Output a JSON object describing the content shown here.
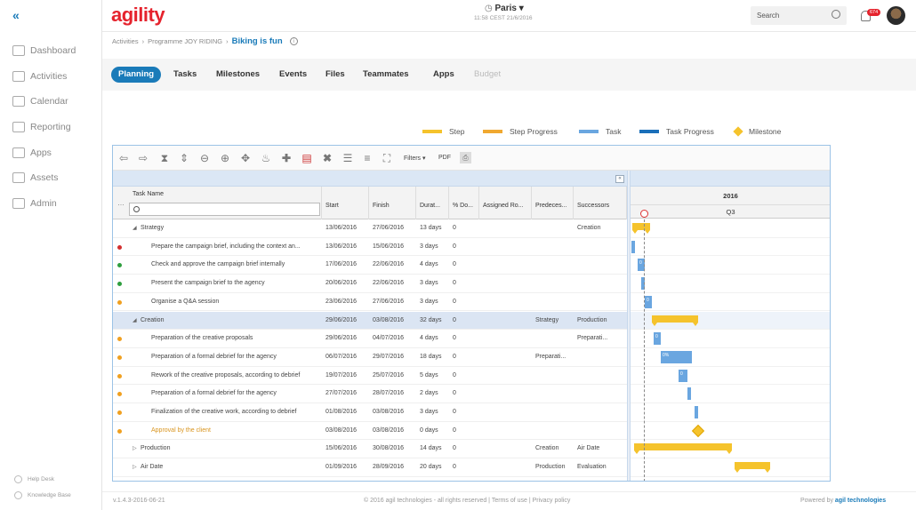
{
  "sidebar": {
    "collapse_icon": "double-chevron-left-icon",
    "items": [
      {
        "label": "Dashboard",
        "icon": "dashboard-icon"
      },
      {
        "label": "Activities",
        "icon": "activities-icon"
      },
      {
        "label": "Calendar",
        "icon": "calendar-icon"
      },
      {
        "label": "Reporting",
        "icon": "chart-icon"
      },
      {
        "label": "Apps",
        "icon": "grid-icon"
      },
      {
        "label": "Assets",
        "icon": "diamond-icon"
      },
      {
        "label": "Admin",
        "icon": "user-icon"
      }
    ],
    "bottom": [
      {
        "label": "Help Desk"
      },
      {
        "label": "Knowledge Base"
      }
    ]
  },
  "header": {
    "logo": "agility",
    "city": "Paris",
    "time": "11:58 CEST 21/6/2016",
    "search_placeholder": "Search",
    "notification_count": "674"
  },
  "breadcrumb": {
    "items": [
      "Activities",
      "Programme JOY RIDING"
    ],
    "current": "Biking is fun"
  },
  "tabs": [
    {
      "label": "Planning",
      "state": "active"
    },
    {
      "label": "Tasks",
      "state": "normal"
    },
    {
      "label": "Milestones",
      "state": "normal"
    },
    {
      "label": "Events",
      "state": "normal"
    },
    {
      "label": "Files",
      "state": "normal"
    },
    {
      "label": "Teammates",
      "state": "normal"
    },
    {
      "label": "Apps",
      "state": "normal"
    },
    {
      "label": "Budget",
      "state": "disabled"
    }
  ],
  "legend": [
    {
      "label": "Step",
      "color": "#f5c32c"
    },
    {
      "label": "Step Progress",
      "color": "#f0a830"
    },
    {
      "label": "Task",
      "color": "#6aa6e0"
    },
    {
      "label": "Task Progress",
      "color": "#1a6fb9"
    },
    {
      "label": "Milestone",
      "color": "#f5c32c"
    }
  ],
  "toolbar": {
    "filters_label": "Filters ▾",
    "pdf_label": "PDF"
  },
  "columns": [
    "Task Name",
    "Start",
    "Finish",
    "Durat...",
    "% Do...",
    "Assigned Ro...",
    "Predeces...",
    "Successors"
  ],
  "timeline": {
    "year": "2016",
    "quarter": "Q3"
  },
  "rows": [
    {
      "dot": "",
      "expander": "◢",
      "name": "Strategy",
      "level": 1,
      "start": "13/06/2016",
      "finish": "27/06/2016",
      "duration": "13 days",
      "pct": "0",
      "assigned": "",
      "pred": "",
      "succ": "Creation"
    },
    {
      "dot": "#d32f2f",
      "expander": "",
      "name": "Prepare the campaign brief, including the context an...",
      "level": 2,
      "start": "13/06/2016",
      "finish": "15/06/2016",
      "duration": "3 days",
      "pct": "0",
      "assigned": "",
      "pred": "",
      "succ": ""
    },
    {
      "dot": "#2e9e3e",
      "expander": "",
      "name": "Check and approve the campaign brief internally",
      "level": 2,
      "start": "17/06/2016",
      "finish": "22/06/2016",
      "duration": "4 days",
      "pct": "0",
      "assigned": "",
      "pred": "",
      "succ": ""
    },
    {
      "dot": "#2e9e3e",
      "expander": "",
      "name": "Present the campaign brief to the agency",
      "level": 2,
      "start": "20/06/2016",
      "finish": "22/06/2016",
      "duration": "3 days",
      "pct": "0",
      "assigned": "",
      "pred": "",
      "succ": ""
    },
    {
      "dot": "#f0a020",
      "expander": "",
      "name": "Organise a Q&A session",
      "level": 2,
      "start": "23/06/2016",
      "finish": "27/06/2016",
      "duration": "3 days",
      "pct": "0",
      "assigned": "",
      "pred": "",
      "succ": ""
    },
    {
      "dot": "",
      "expander": "◢",
      "name": "Creation",
      "level": 1,
      "start": "29/06/2016",
      "finish": "03/08/2016",
      "duration": "32 days",
      "pct": "0",
      "assigned": "",
      "pred": "Strategy",
      "succ": "Production",
      "selected": true
    },
    {
      "dot": "#f0a020",
      "expander": "",
      "name": "Preparation of the creative proposals",
      "level": 2,
      "start": "29/06/2016",
      "finish": "04/07/2016",
      "duration": "4 days",
      "pct": "0",
      "assigned": "",
      "pred": "",
      "succ": "Preparati..."
    },
    {
      "dot": "#f0a020",
      "expander": "",
      "name": "Preparation of a formal debrief for the agency",
      "level": 2,
      "start": "06/07/2016",
      "finish": "29/07/2016",
      "duration": "18 days",
      "pct": "0",
      "assigned": "",
      "pred": "Preparati...",
      "succ": ""
    },
    {
      "dot": "#f0a020",
      "expander": "",
      "name": "Rework of the creative proposals, according to debrief",
      "level": 2,
      "start": "19/07/2016",
      "finish": "25/07/2016",
      "duration": "5 days",
      "pct": "0",
      "assigned": "",
      "pred": "",
      "succ": ""
    },
    {
      "dot": "#f0a020",
      "expander": "",
      "name": "Preparation of a formal debrief for the agency",
      "level": 2,
      "start": "27/07/2016",
      "finish": "28/07/2016",
      "duration": "2 days",
      "pct": "0",
      "assigned": "",
      "pred": "",
      "succ": ""
    },
    {
      "dot": "#f0a020",
      "expander": "",
      "name": "Finalization of the creative work, according to debrief",
      "level": 2,
      "start": "01/08/2016",
      "finish": "03/08/2016",
      "duration": "3 days",
      "pct": "0",
      "assigned": "",
      "pred": "",
      "succ": ""
    },
    {
      "dot": "#f0a020",
      "expander": "",
      "name": "Approval by the client",
      "level": 2,
      "start": "03/08/2016",
      "finish": "03/08/2016",
      "duration": "0 days",
      "pct": "0",
      "assigned": "",
      "pred": "",
      "succ": "",
      "milestone": true
    },
    {
      "dot": "",
      "expander": "▷",
      "name": "Production",
      "level": 1,
      "start": "15/06/2016",
      "finish": "30/08/2016",
      "duration": "14 days",
      "pct": "0",
      "assigned": "",
      "pred": "Creation",
      "succ": "Air Date"
    },
    {
      "dot": "",
      "expander": "▷",
      "name": "Air Date",
      "level": 1,
      "start": "01/09/2016",
      "finish": "28/09/2016",
      "duration": "20 days",
      "pct": "0",
      "assigned": "",
      "pred": "Production",
      "succ": "Evaluation"
    }
  ],
  "bars": [
    {
      "type": "step"
    },
    {
      "type": "task",
      "label": ""
    },
    {
      "type": "task",
      "label": "0"
    },
    {
      "type": "task",
      "label": ""
    },
    {
      "type": "task",
      "label": "0"
    },
    {
      "type": "step"
    },
    {
      "type": "task",
      "label": "0"
    },
    {
      "type": "task",
      "label": "0%"
    },
    {
      "type": "task",
      "label": "0"
    },
    {
      "type": "task",
      "label": ""
    },
    {
      "type": "task",
      "label": ""
    },
    {
      "type": "milestone"
    },
    {
      "type": "step"
    },
    {
      "type": "step"
    }
  ],
  "footer": {
    "version": "v.1.4.3-2016-06-21",
    "copyright": "© 2016 agil technologies - all rights reserved | Terms of use | Privacy policy",
    "powered": "Powered by",
    "brand": "agil technologies"
  }
}
